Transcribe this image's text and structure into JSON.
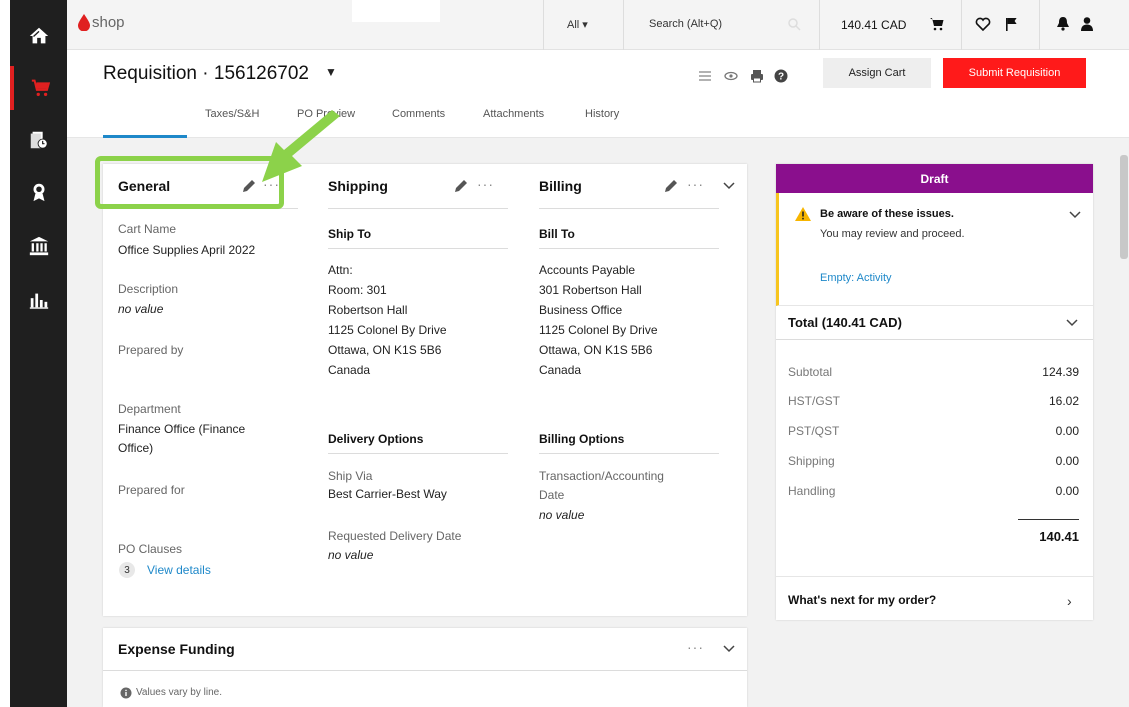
{
  "colors": {
    "rail_bg": "#1f1f1f",
    "accent_red": "#ff1a1a",
    "draft_purple": "#8a0f8d",
    "highlight_green": "#8cd24a",
    "link_blue": "#1e88c9",
    "warn_yellow": "#f7c51f"
  },
  "rail": {
    "items": [
      {
        "icon": "home-icon"
      },
      {
        "icon": "cart-icon",
        "active": true
      },
      {
        "icon": "documents-clock-icon"
      },
      {
        "icon": "award-ribbon-icon"
      },
      {
        "icon": "bank-icon"
      },
      {
        "icon": "bar-chart-icon"
      }
    ]
  },
  "topbar": {
    "logo_text": "shop",
    "scope_label": "All ▾",
    "search_placeholder": "Search (Alt+Q)",
    "cart_total": "140.41 CAD"
  },
  "header": {
    "title": "Requisition · 156126702",
    "caret": "▼",
    "assign_cart_label": "Assign Cart",
    "submit_label": "Submit Requisition"
  },
  "tabs": [
    "Taxes/S&H",
    "PO Preview",
    "Comments",
    "Attachments",
    "History"
  ],
  "general": {
    "title": "General",
    "cart_name_label": "Cart Name",
    "cart_name_value": "Office Supplies April 2022",
    "description_label": "Description",
    "description_value": "no value",
    "prepared_by_label": "Prepared by",
    "department_label": "Department",
    "department_value_line1": "Finance Office (Finance",
    "department_value_line2": "Office)",
    "prepared_for_label": "Prepared for",
    "po_clauses_label": "PO Clauses",
    "po_clauses_count": "3",
    "po_clauses_link": "View details"
  },
  "shipping": {
    "title": "Shipping",
    "ship_to_title": "Ship To",
    "address": [
      "Attn:",
      "Room: 301",
      "Robertson Hall",
      "1125 Colonel By Drive",
      "Ottawa, ON K1S 5B6",
      "Canada"
    ],
    "delivery_options_title": "Delivery Options",
    "ship_via_label": "Ship Via",
    "ship_via_value": "Best Carrier-Best Way",
    "requested_delivery_label": "Requested Delivery Date",
    "requested_delivery_value": "no value"
  },
  "billing": {
    "title": "Billing",
    "bill_to_title": "Bill To",
    "address": [
      "Accounts Payable",
      "301 Robertson Hall",
      "Business Office",
      "1125 Colonel By Drive",
      "Ottawa, ON K1S 5B6",
      "Canada"
    ],
    "billing_options_title": "Billing Options",
    "txn_label_line1": "Transaction/Accounting",
    "txn_label_line2": "Date",
    "txn_value": "no value"
  },
  "expense": {
    "title": "Expense Funding",
    "note": "Values vary by line."
  },
  "summary": {
    "status": "Draft",
    "warning_title": "Be aware of these issues.",
    "warning_sub": "You may review and proceed.",
    "warning_link": "Empty: Activity",
    "total_title": "Total (140.41 CAD)",
    "rows": [
      {
        "label": "Subtotal",
        "value": "124.39"
      },
      {
        "label": "HST/GST",
        "value": "16.02"
      },
      {
        "label": "PST/QST",
        "value": "0.00"
      },
      {
        "label": "Shipping",
        "value": "0.00"
      },
      {
        "label": "Handling",
        "value": "0.00"
      }
    ],
    "grand_total": "140.41",
    "whats_next": "What's next for my order?"
  }
}
